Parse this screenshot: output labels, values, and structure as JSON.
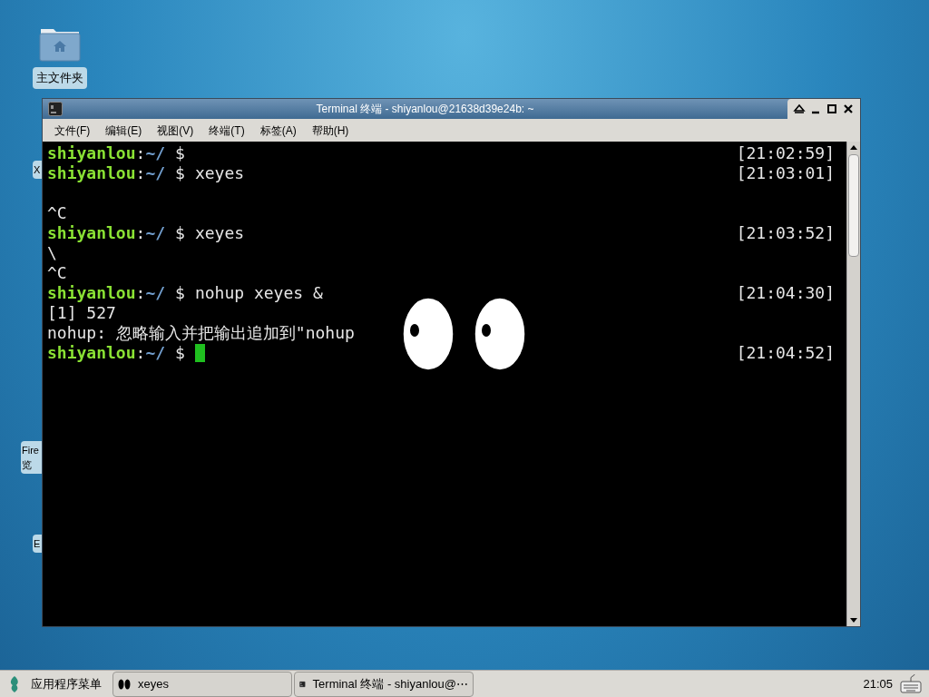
{
  "desktop_icons": [
    {
      "kind": "folder",
      "label": "主文件夹"
    }
  ],
  "hidden_labels": [
    {
      "lines": [
        "X"
      ]
    },
    {
      "lines": [
        "Fire",
        "览"
      ]
    },
    {
      "lines": [
        "E"
      ]
    }
  ],
  "window": {
    "title": "Terminal 终端 - shiyanlou@21638d39e24b: ~",
    "menu": [
      "文件(F)",
      "编辑(E)",
      "视图(V)",
      "终端(T)",
      "标签(A)",
      "帮助(H)"
    ],
    "terminal": {
      "lines": [
        {
          "kind": "prompt",
          "user": "shiyanlou",
          "sep": ":",
          "path": "~/",
          "symbol": "$",
          "time": "[21:02:59]",
          "cursor": false
        },
        {
          "kind": "prompt",
          "user": "shiyanlou",
          "sep": ":",
          "path": "~/",
          "symbol": "$",
          "command": "xeyes",
          "time": "[21:03:01]",
          "cursor": false
        },
        {
          "kind": "blank"
        },
        {
          "kind": "output",
          "text": "^C"
        },
        {
          "kind": "prompt",
          "user": "shiyanlou",
          "sep": ":",
          "path": "~/",
          "symbol": "$",
          "command": "xeyes",
          "time": "[21:03:52]",
          "cursor": false
        },
        {
          "kind": "output",
          "text": "\\"
        },
        {
          "kind": "output",
          "text": "^C"
        },
        {
          "kind": "prompt",
          "user": "shiyanlou",
          "sep": ":",
          "path": "~/",
          "symbol": "$",
          "command": "nohup xeyes &",
          "time": "[21:04:30]",
          "cursor": false
        },
        {
          "kind": "output",
          "text": "[1] 527"
        },
        {
          "kind": "output",
          "text": "nohup: 忽略输入并把输出追加到\"nohup"
        },
        {
          "kind": "prompt",
          "user": "shiyanlou",
          "sep": ":",
          "path": "~/",
          "symbol": "$",
          "time": "[21:04:52]",
          "cursor": true
        }
      ]
    }
  },
  "taskbar": {
    "menu": "应用程序菜单",
    "tasks": [
      {
        "kind": "eyes",
        "label": "xeyes",
        "selected": false
      },
      {
        "kind": "terminal",
        "label": "Terminal 终端 - shiyanlou@⋯",
        "selected": false
      }
    ],
    "clock": "21:05"
  }
}
